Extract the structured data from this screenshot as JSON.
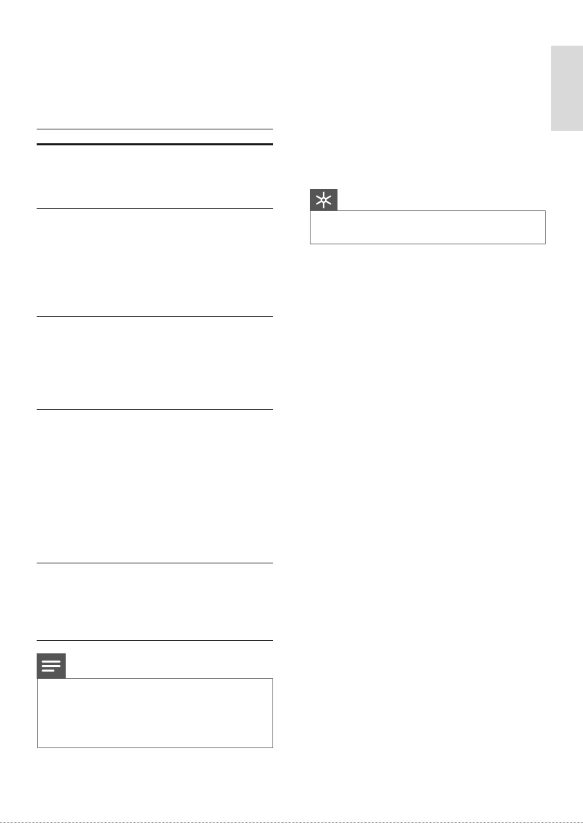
{
  "page": {
    "side_tab_color": "#d9d9d9",
    "rule_color": "#1a1a1a"
  },
  "tip": {
    "icon": "asterisk-icon",
    "tab_color": "#555555",
    "text": ""
  },
  "note": {
    "icon": "note-lines-icon",
    "tab_color": "#555555",
    "text": ""
  }
}
